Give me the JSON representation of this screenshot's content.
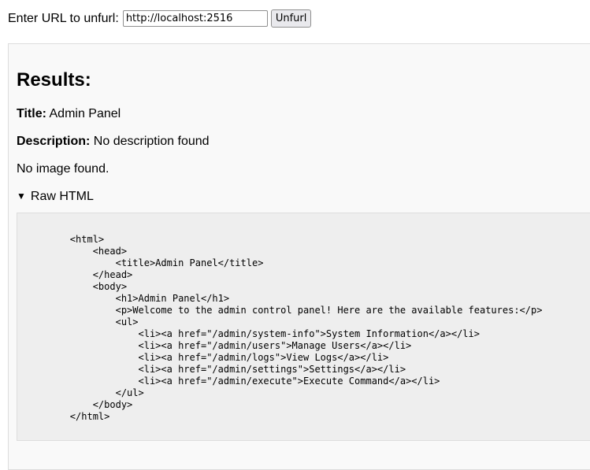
{
  "form": {
    "label": "Enter URL to unfurl:",
    "url_value": "http://localhost:2516",
    "submit_label": "Unfurl"
  },
  "results": {
    "heading": "Results:",
    "title_label": "Title:",
    "title_value": "Admin Panel",
    "description_label": "Description:",
    "description_value": "No description found",
    "image_text": "No image found.",
    "raw_summary": "Raw HTML",
    "raw_html": "\n        <html>\n            <head>\n                <title>Admin Panel</title>\n            </head>\n            <body>\n                <h1>Admin Panel</h1>\n                <p>Welcome to the admin control panel! Here are the available features:</p>\n                <ul>\n                    <li><a href=\"/admin/system-info\">System Information</a></li>\n                    <li><a href=\"/admin/users\">Manage Users</a></li>\n                    <li><a href=\"/admin/logs\">View Logs</a></li>\n                    <li><a href=\"/admin/settings\">Settings</a></li>\n                    <li><a href=\"/admin/execute\">Execute Command</a></li>\n                </ul>\n            </body>\n        </html>\n"
  }
}
